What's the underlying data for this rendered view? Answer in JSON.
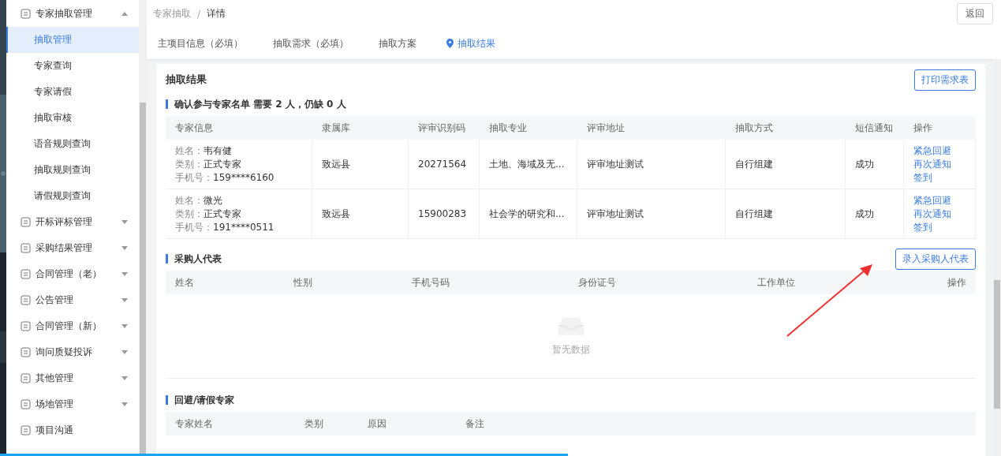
{
  "sidebar": {
    "group": {
      "label": "专家抽取管理",
      "expanded": true,
      "children": [
        {
          "label": "抽取管理",
          "selected": true
        },
        {
          "label": "专家查询",
          "selected": false
        },
        {
          "label": "专家请假",
          "selected": false
        },
        {
          "label": "抽取审核",
          "selected": false
        },
        {
          "label": "语音规则查询",
          "selected": false
        },
        {
          "label": "抽取规则查询",
          "selected": false
        },
        {
          "label": "请假规则查询",
          "selected": false
        }
      ]
    },
    "items": [
      {
        "label": "开标评标管理",
        "expandable": true
      },
      {
        "label": "采购结果管理",
        "expandable": true
      },
      {
        "label": "合同管理（老）",
        "expandable": true
      },
      {
        "label": "公告管理",
        "expandable": true
      },
      {
        "label": "合同管理（新）",
        "expandable": true
      },
      {
        "label": "询问质疑投诉",
        "expandable": true
      },
      {
        "label": "其他管理",
        "expandable": true
      },
      {
        "label": "场地管理",
        "expandable": true
      },
      {
        "label": "项目沟通",
        "expandable": false
      }
    ]
  },
  "breadcrumb": [
    "专家抽取",
    "详情"
  ],
  "breadcrumb_separator": "/",
  "back_button": "返回",
  "tabs": [
    {
      "label": "主项目信息（必填）",
      "selected": false
    },
    {
      "label": "抽取需求（必填）",
      "selected": false
    },
    {
      "label": "抽取方案",
      "selected": false
    },
    {
      "label": "抽取结果",
      "selected": true
    }
  ],
  "panel": {
    "title": "抽取结果",
    "print_button": "打印需求表"
  },
  "experts": {
    "title": "确认参与专家名单 需要 2 人，仍缺 0 人",
    "columns": [
      "专家信息",
      "隶属库",
      "评审识别码",
      "抽取专业",
      "评审地址",
      "抽取方式",
      "短信通知",
      "操作"
    ],
    "rows": [
      {
        "info": [
          {
            "label": "姓名：",
            "value": "韦有健"
          },
          {
            "label": "类别：",
            "value": "正式专家"
          },
          {
            "label": "手机号：",
            "value": "159****6160"
          }
        ],
        "library": "致远县",
        "code": "20271564",
        "major": "土地、海域及无...",
        "address": "评审地址测试",
        "method": "自行组建",
        "sms": "成功",
        "actions": [
          "紧急回避",
          "再次通知",
          "签到"
        ]
      },
      {
        "info": [
          {
            "label": "姓名：",
            "value": "微光"
          },
          {
            "label": "类别：",
            "value": "正式专家"
          },
          {
            "label": "手机号：",
            "value": "191****0511"
          }
        ],
        "library": "致远县",
        "code": "15900283",
        "major": "社会学的研究和...",
        "address": "评审地址测试",
        "method": "自行组建",
        "sms": "成功",
        "actions": [
          "紧急回避",
          "再次通知",
          "签到"
        ]
      }
    ]
  },
  "purchasers": {
    "title": "采购人代表",
    "add_button": "录入采购人代表",
    "columns": [
      "姓名",
      "性别",
      "手机号码",
      "身份证号",
      "工作单位",
      "操作"
    ],
    "empty_text": "暂无数据"
  },
  "avoided": {
    "title": "回避/请假专家",
    "columns": [
      "专家姓名",
      "类别",
      "原因",
      "备注"
    ]
  }
}
